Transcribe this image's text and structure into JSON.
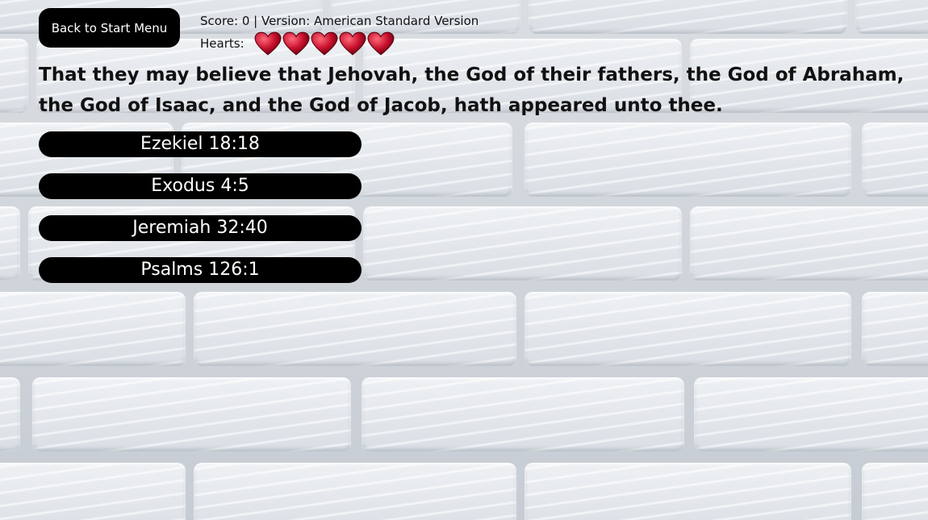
{
  "header": {
    "back_label": "Back to Start Menu",
    "score_text": "Score: 0 | Version: American Standard Version",
    "hearts_label": "Hearts:",
    "hearts_count": 5,
    "heart_color": "#c8102e"
  },
  "question": {
    "verse": "That they may believe that Jehovah, the God of their fathers, the God of Abraham, the God of Isaac, and the God of Jacob, hath appeared unto thee."
  },
  "choices": [
    {
      "label": "Ezekiel 18:18"
    },
    {
      "label": "Exodus 4:5"
    },
    {
      "label": "Jeremiah 32:40"
    },
    {
      "label": "Psalms 126:1"
    }
  ]
}
